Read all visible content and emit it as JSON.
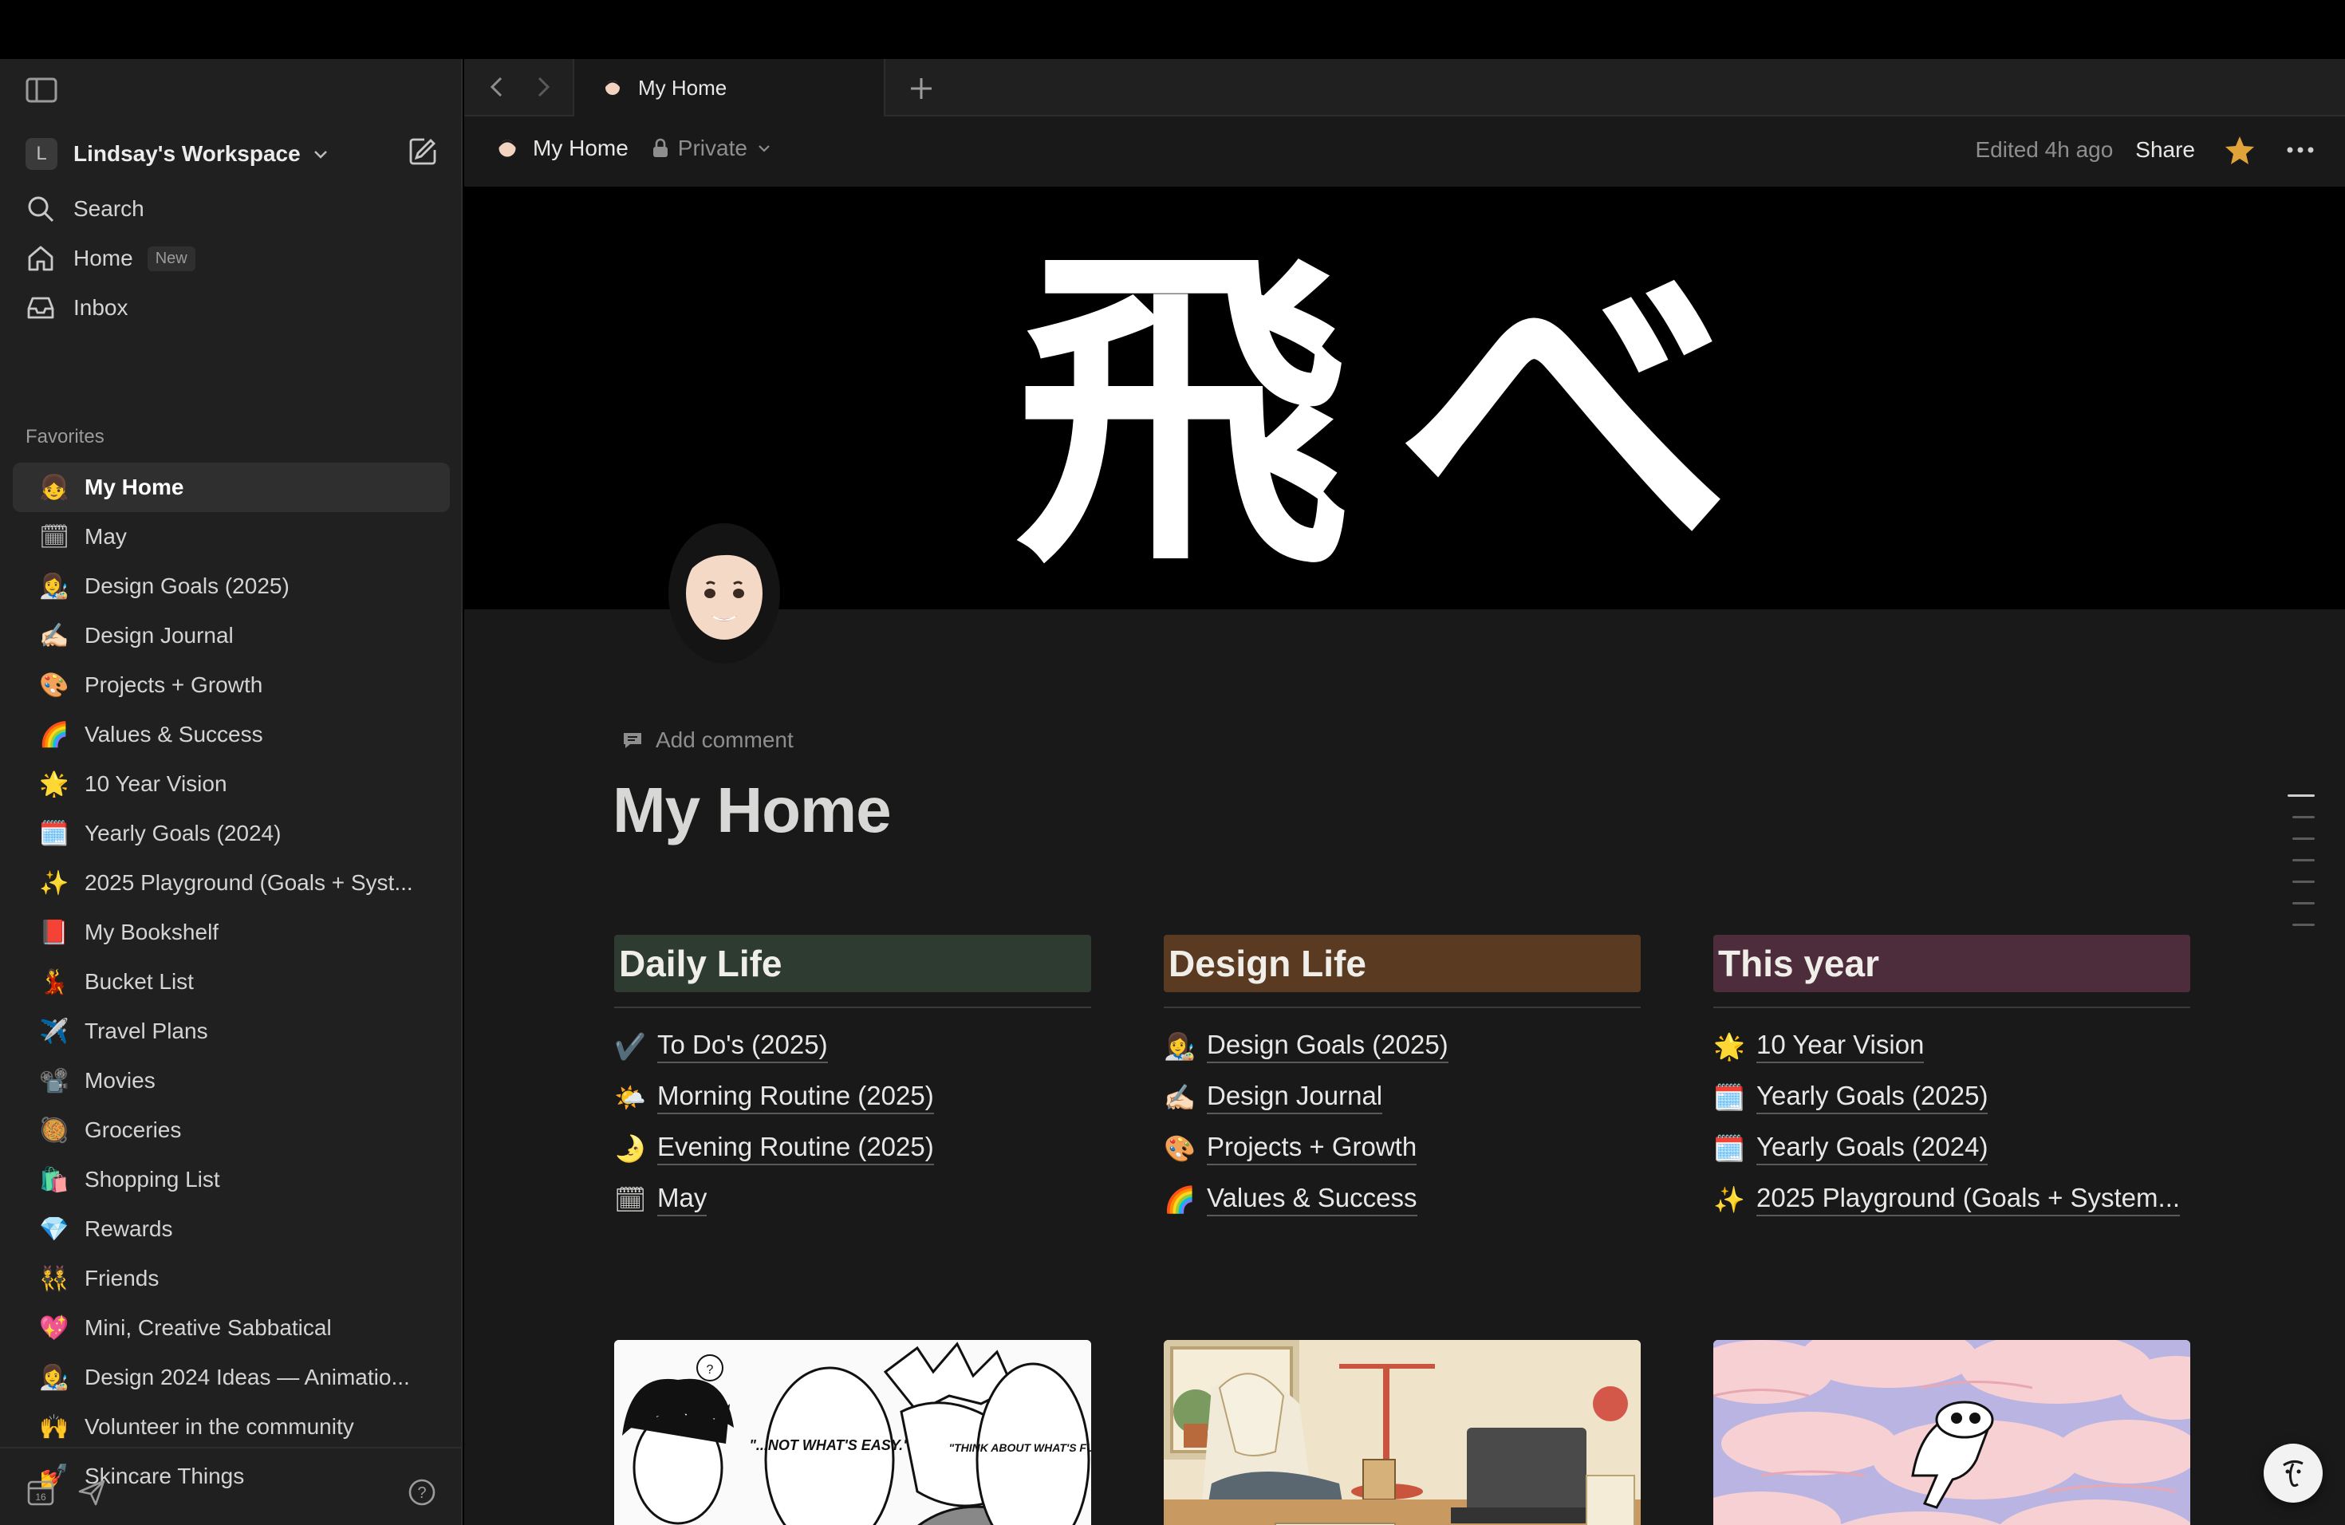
{
  "sidebar": {
    "workspace": {
      "initial": "L",
      "name": "Lindsay's Workspace"
    },
    "nav": {
      "search": "Search",
      "home": "Home",
      "home_badge": "New",
      "inbox": "Inbox"
    },
    "favorites_heading": "Favorites",
    "favorites": [
      {
        "icon": "👧",
        "label": "My Home"
      },
      {
        "icon": "🗓",
        "label": "May"
      },
      {
        "icon": "👩‍🎨",
        "label": "Design Goals (2025)"
      },
      {
        "icon": "✍🏻",
        "label": "Design Journal"
      },
      {
        "icon": "🎨",
        "label": "Projects + Growth"
      },
      {
        "icon": "🌈",
        "label": "Values & Success"
      },
      {
        "icon": "🌟",
        "label": "10 Year Vision"
      },
      {
        "icon": "🗓️",
        "label": "Yearly Goals (2024)"
      },
      {
        "icon": "✨",
        "label": "2025 Playground (Goals + Syst..."
      },
      {
        "icon": "📕",
        "label": "My Bookshelf"
      },
      {
        "icon": "💃",
        "label": "Bucket List"
      },
      {
        "icon": "✈️",
        "label": "Travel Plans"
      },
      {
        "icon": "📽️",
        "label": "Movies"
      },
      {
        "icon": "🥘",
        "label": "Groceries"
      },
      {
        "icon": "🛍️",
        "label": "Shopping List"
      },
      {
        "icon": "💎",
        "label": "Rewards"
      },
      {
        "icon": "👯",
        "label": "Friends"
      },
      {
        "icon": "💖",
        "label": "Mini, Creative Sabbatical"
      },
      {
        "icon": "👩‍🎨",
        "label": "Design 2024 Ideas — Animatio..."
      },
      {
        "icon": "🙌",
        "label": "Volunteer in the community"
      },
      {
        "icon": "💅",
        "label": "Skincare Things"
      }
    ]
  },
  "tabs": {
    "active_tab": "My Home"
  },
  "header": {
    "breadcrumb": "My Home",
    "privacy": "Private",
    "edited": "Edited 4h ago",
    "share": "Share"
  },
  "page": {
    "cover_text": "飛べ",
    "add_comment": "Add comment",
    "title": "My Home",
    "columns": [
      {
        "heading": "Daily Life",
        "color": "#2d3b30",
        "links": [
          {
            "icon": "✔️",
            "label": "To Do's (2025)"
          },
          {
            "icon": "🌤️",
            "label": "Morning Routine (2025)"
          },
          {
            "icon": "🌛",
            "label": "Evening Routine (2025)"
          },
          {
            "icon": "🗓",
            "label": "May"
          }
        ]
      },
      {
        "heading": "Design Life",
        "color": "#5b3a22",
        "links": [
          {
            "icon": "👩‍🎨",
            "label": "Design Goals (2025)"
          },
          {
            "icon": "✍🏻",
            "label": "Design Journal"
          },
          {
            "icon": "🎨",
            "label": "Projects + Growth"
          },
          {
            "icon": "🌈",
            "label": "Values & Success"
          }
        ]
      },
      {
        "heading": "This year",
        "color": "#4d2c3c",
        "links": [
          {
            "icon": "🌟",
            "label": "10 Year Vision"
          },
          {
            "icon": "🗓️",
            "label": "Yearly Goals (2025)"
          },
          {
            "icon": "🗓️",
            "label": "Yearly Goals (2024)"
          },
          {
            "icon": "✨",
            "label": "2025 Playground (Goals + System..."
          }
        ]
      }
    ],
    "manga_bubble_left": "\"...NOT WHAT'S EASY.\"",
    "manga_bubble_right": "\"THINK ABOUT WHAT'S FUN...\"",
    "manga_small_bubble": "?"
  },
  "colors": {
    "sidebar_bg": "#202020",
    "page_bg": "#191919",
    "accent_star": "#e0a33a"
  }
}
